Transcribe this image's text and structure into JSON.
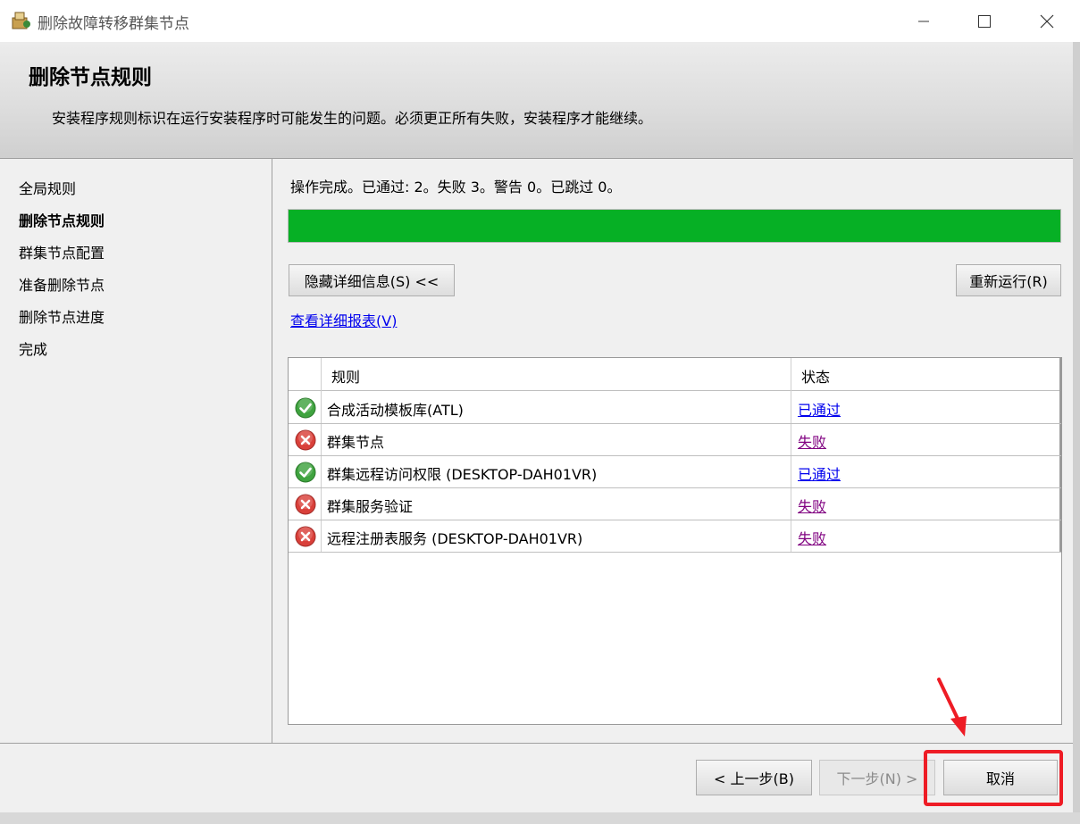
{
  "window": {
    "title": "删除故障转移群集节点"
  },
  "header": {
    "title": "删除节点规则",
    "description": "安装程序规则标识在运行安装程序时可能发生的问题。必须更正所有失败，安装程序才能继续。"
  },
  "nav": {
    "items": [
      {
        "label": "全局规则",
        "active": false
      },
      {
        "label": "删除节点规则",
        "active": true
      },
      {
        "label": "群集节点配置",
        "active": false
      },
      {
        "label": "准备删除节点",
        "active": false
      },
      {
        "label": "删除节点进度",
        "active": false
      },
      {
        "label": "完成",
        "active": false
      }
    ]
  },
  "main": {
    "status_text": "操作完成。已通过: 2。失败 3。警告 0。已跳过 0。",
    "progress": 1.0,
    "progress_color": "#06b025",
    "hide_details_label": "隐藏详细信息(S) <<",
    "rerun_label": "重新运行(R)",
    "report_link": "查看详细报表(V)",
    "table": {
      "headers": {
        "rule": "规则",
        "status": "状态"
      },
      "rows": [
        {
          "icon": "success-check-icon",
          "rule": "合成活动模板库(ATL)",
          "status": "已通过",
          "result": "pass"
        },
        {
          "icon": "error-x-icon",
          "rule": "群集节点",
          "status": "失败",
          "result": "fail"
        },
        {
          "icon": "success-check-icon",
          "rule": "群集远程访问权限 (DESKTOP-DAH01VR)",
          "status": "已通过",
          "result": "pass"
        },
        {
          "icon": "error-x-icon",
          "rule": "群集服务验证",
          "status": "失败",
          "result": "fail"
        },
        {
          "icon": "error-x-icon",
          "rule": "远程注册表服务 (DESKTOP-DAH01VR)",
          "status": "失败",
          "result": "fail"
        }
      ]
    }
  },
  "footer": {
    "back_label": "< 上一步(B)",
    "next_label": "下一步(N) >",
    "cancel_label": "取消"
  },
  "colors": {
    "annotation": "#ee1c25",
    "pass_link": "#0000ee",
    "fail_link": "#800080"
  }
}
